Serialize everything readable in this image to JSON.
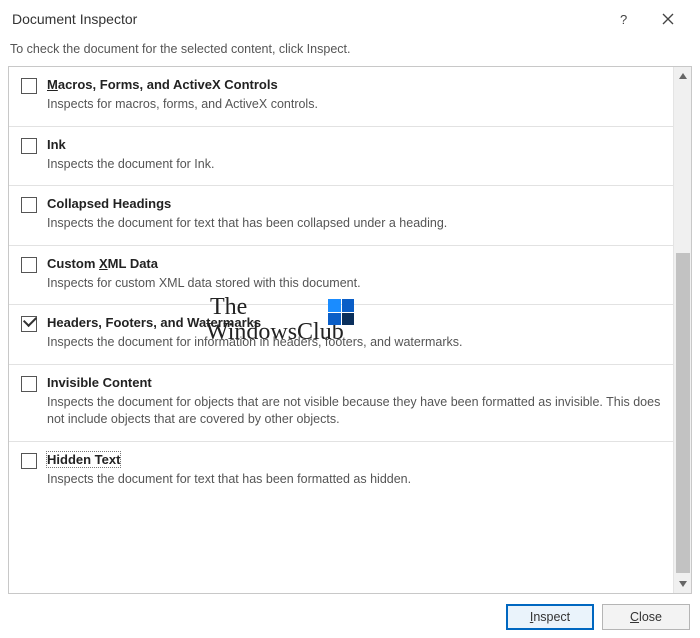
{
  "dialog": {
    "title": "Document Inspector",
    "instruction": "To check the document for the selected content, click Inspect."
  },
  "items": [
    {
      "title_prefix": "",
      "title_underline": "M",
      "title_rest": "acros, Forms, and ActiveX Controls",
      "desc": "Inspects for macros, forms, and ActiveX controls.",
      "checked": false
    },
    {
      "title_prefix": "",
      "title_underline": "",
      "title_rest": "Ink",
      "desc": "Inspects the document for Ink.",
      "checked": false
    },
    {
      "title_prefix": "",
      "title_underline": "",
      "title_rest": "Collapsed Headings",
      "desc": "Inspects the document for text that has been collapsed under a heading.",
      "checked": false
    },
    {
      "title_prefix": "Custom ",
      "title_underline": "X",
      "title_rest": "ML Data",
      "desc": "Inspects for custom XML data stored with this document.",
      "checked": false
    },
    {
      "title_prefix": "",
      "title_underline": "",
      "title_rest": "Headers, Footers, and Watermarks",
      "desc": "Inspects the document for information in headers, footers, and watermarks.",
      "checked": true
    },
    {
      "title_prefix": "",
      "title_underline": "",
      "title_rest": "Invisible Content",
      "desc": "Inspects the document for objects that are not visible because they have been formatted as invisible. This does not include objects that are covered by other objects.",
      "checked": false
    },
    {
      "title_prefix": "",
      "title_underline": "",
      "title_rest": "Hidden Text",
      "desc": "Inspects the document for text that has been formatted as hidden.",
      "checked": false,
      "focused": true
    }
  ],
  "buttons": {
    "inspect": "Inspect",
    "close": "Close",
    "inspect_underline": "I",
    "close_underline": "C"
  },
  "watermark": {
    "line1": "The",
    "line2": "WindowsClub"
  }
}
